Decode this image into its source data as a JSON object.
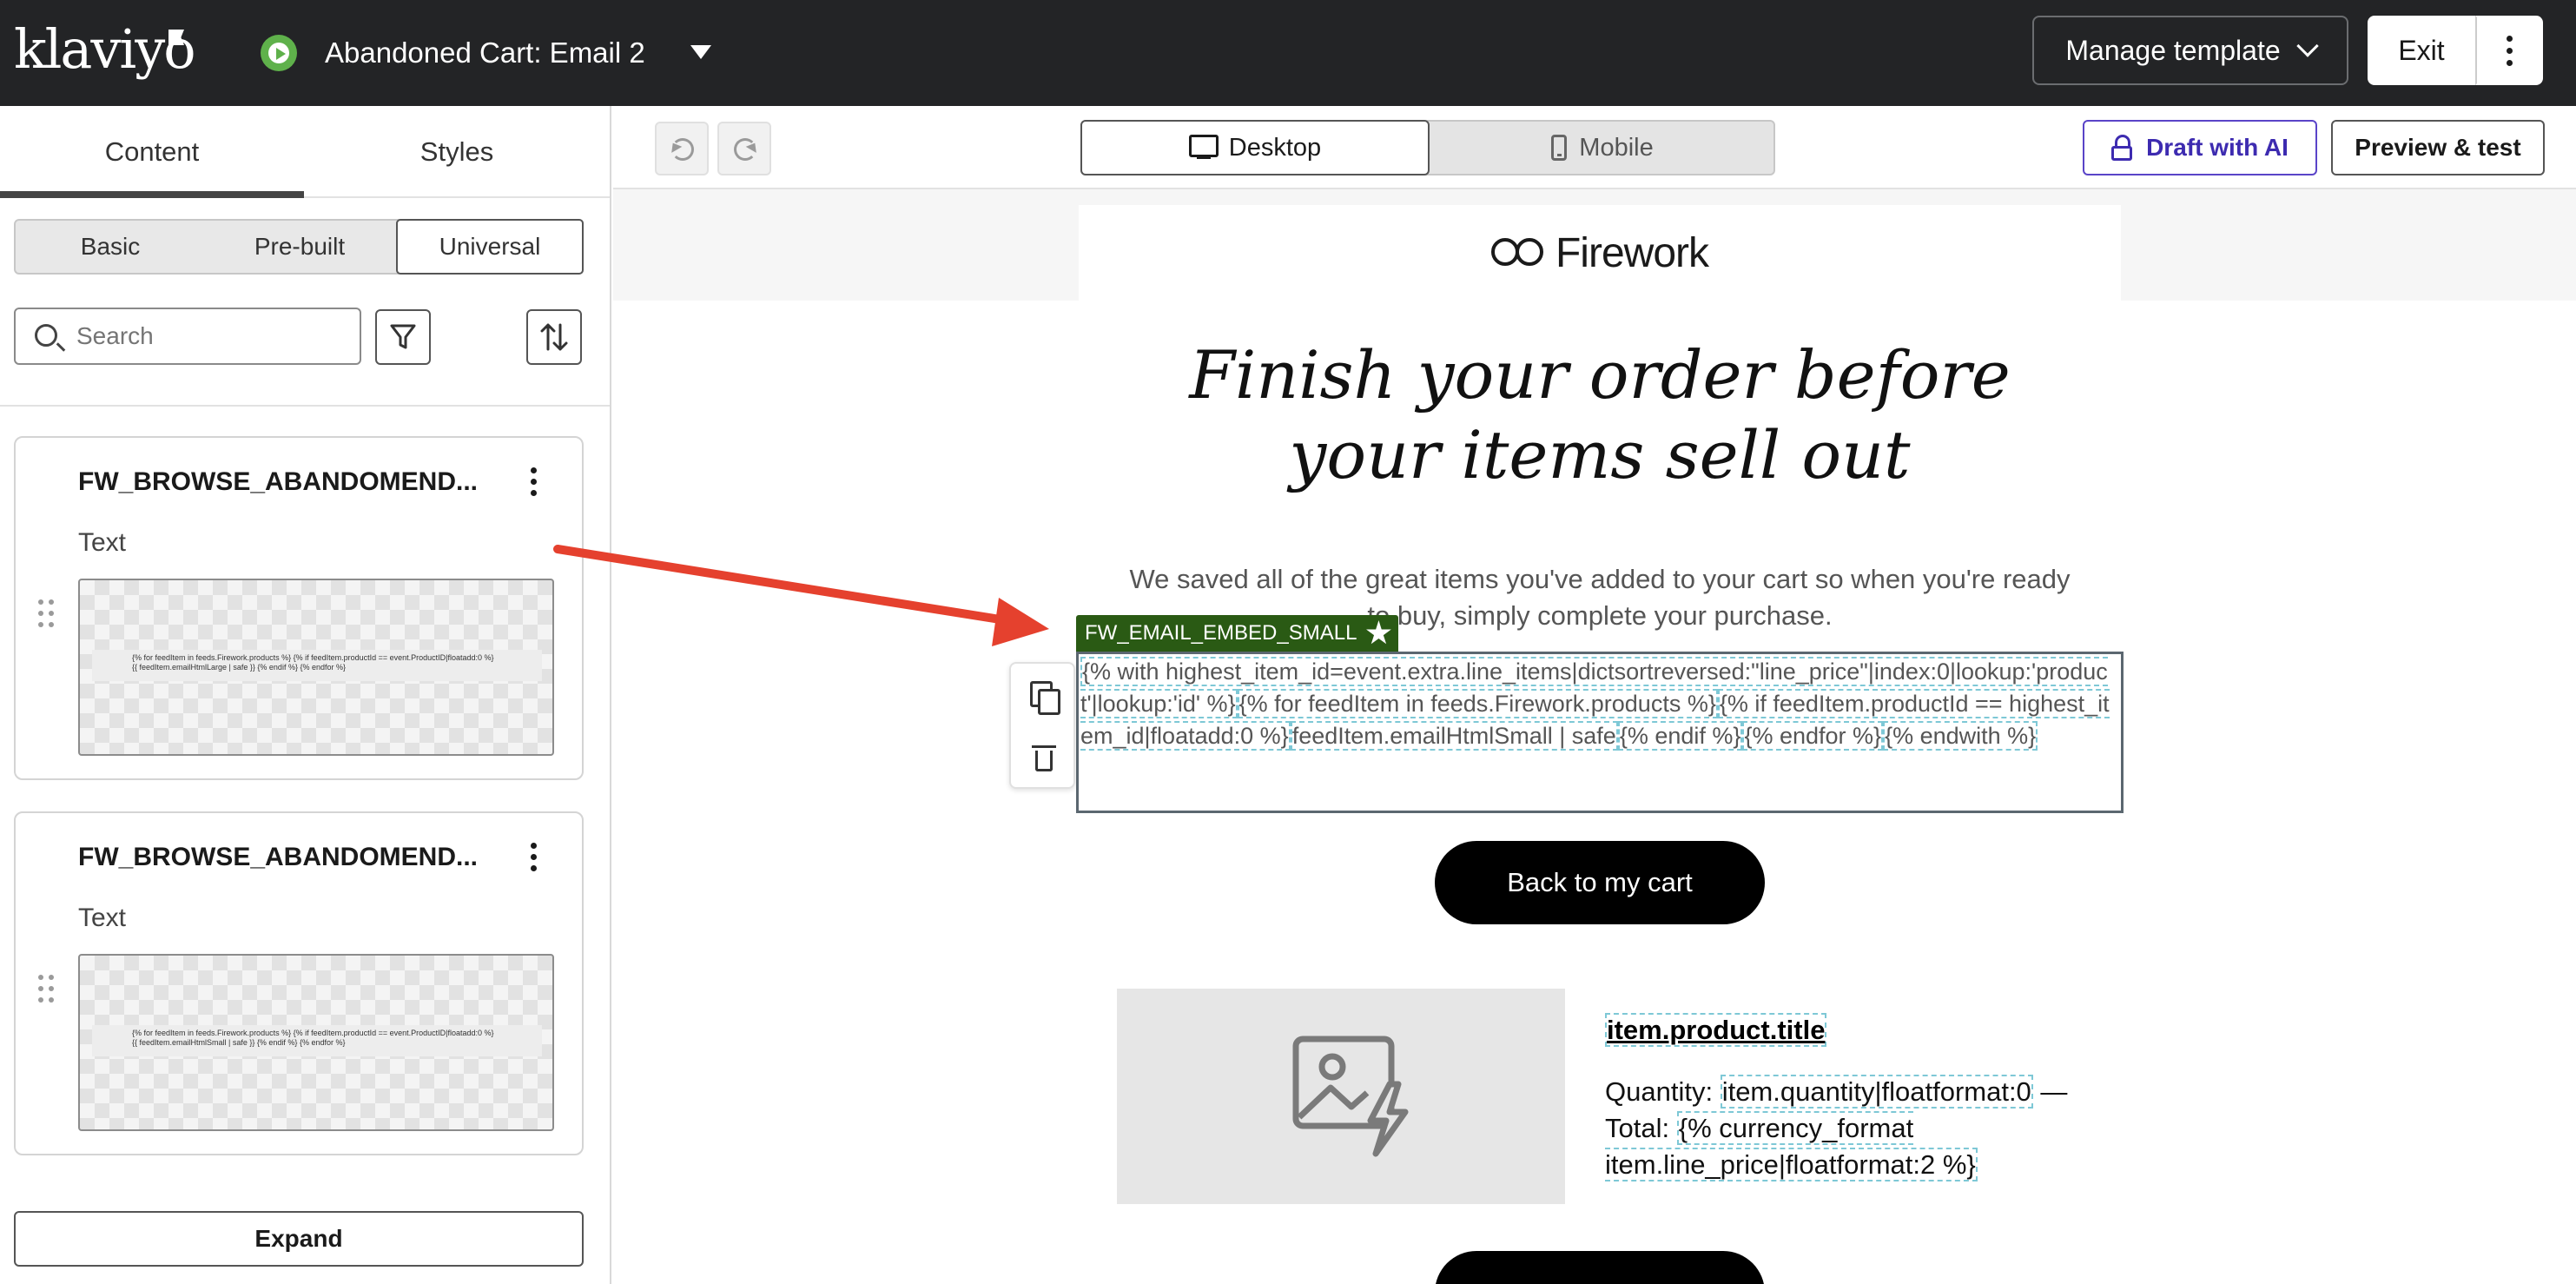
{
  "app": {
    "logo_text": "klaviyo",
    "page_name": "Abandoned Cart: Email 2",
    "manage_template_label": "Manage template",
    "exit_label": "Exit",
    "colors": {
      "topbar": "#232426",
      "status_green": "#5fb14b",
      "block_tag": "#2a5a14",
      "ai_accent": "#3d2bb0",
      "annotation_arrow": "#e5412e"
    }
  },
  "left_panel": {
    "tabs": [
      "Content",
      "Styles"
    ],
    "active_tab": "Content",
    "library_filters": [
      "Basic",
      "Pre-built",
      "Universal"
    ],
    "active_filter": "Universal",
    "search": {
      "placeholder": "Search",
      "value": ""
    },
    "blocks": [
      {
        "title": "FW_BROWSE_ABANDOMEND...",
        "type": "Text",
        "preview_text": "{% for feedItem in feeds.Firework.products %} {% if feedItem.productId == event.ProductID|floatadd:0 %} {{ feedItem.emailHtmlLarge | safe }} {% endif %} {% endfor %}"
      },
      {
        "title": "FW_BROWSE_ABANDOMEND...",
        "type": "Text",
        "preview_text": "{% for feedItem in feeds.Firework.products %} {% if feedItem.productId == event.ProductID|floatadd:0 %} {{ feedItem.emailHtmlSmall | safe }} {% endif %} {% endfor %}"
      }
    ],
    "expand_label": "Expand"
  },
  "editor": {
    "device_options": [
      "Desktop",
      "Mobile"
    ],
    "active_device": "Desktop",
    "draft_ai_label": "Draft with AI",
    "preview_label": "Preview & test"
  },
  "email": {
    "brand_name": "Firework",
    "headline_line1": "Finish your order before",
    "headline_line2": "your items sell out",
    "subcopy": "We saved all of the great items you've added to your cart so when you're ready to buy, simply complete your purchase.",
    "selected_block_tag": "FW_EMAIL_EMBED_SMALL",
    "code_tokens": [
      "{% with highest_item_id=event.extra.line_items|dictsortreversed:\"line_price\"|index:0|lookup:'product'|lookup:'id' %}",
      "{% for feedItem in feeds.Firework.products %}",
      "{% if feedItem.productId == highest_item_id|floatadd:0 %}",
      "feedItem.emailHtmlSmall | safe",
      "{% endif %}",
      "{% endfor %}",
      "{% endwith %}"
    ],
    "cart_button_label": "Back to my cart",
    "product": {
      "title": "item.product.title",
      "quantity_label": "Quantity:",
      "quantity_value": "item.quantity|floatformat:0",
      "total_label": "— Total:",
      "total_value": "{% currency_format item.line_price|floatformat:2 %}"
    }
  }
}
